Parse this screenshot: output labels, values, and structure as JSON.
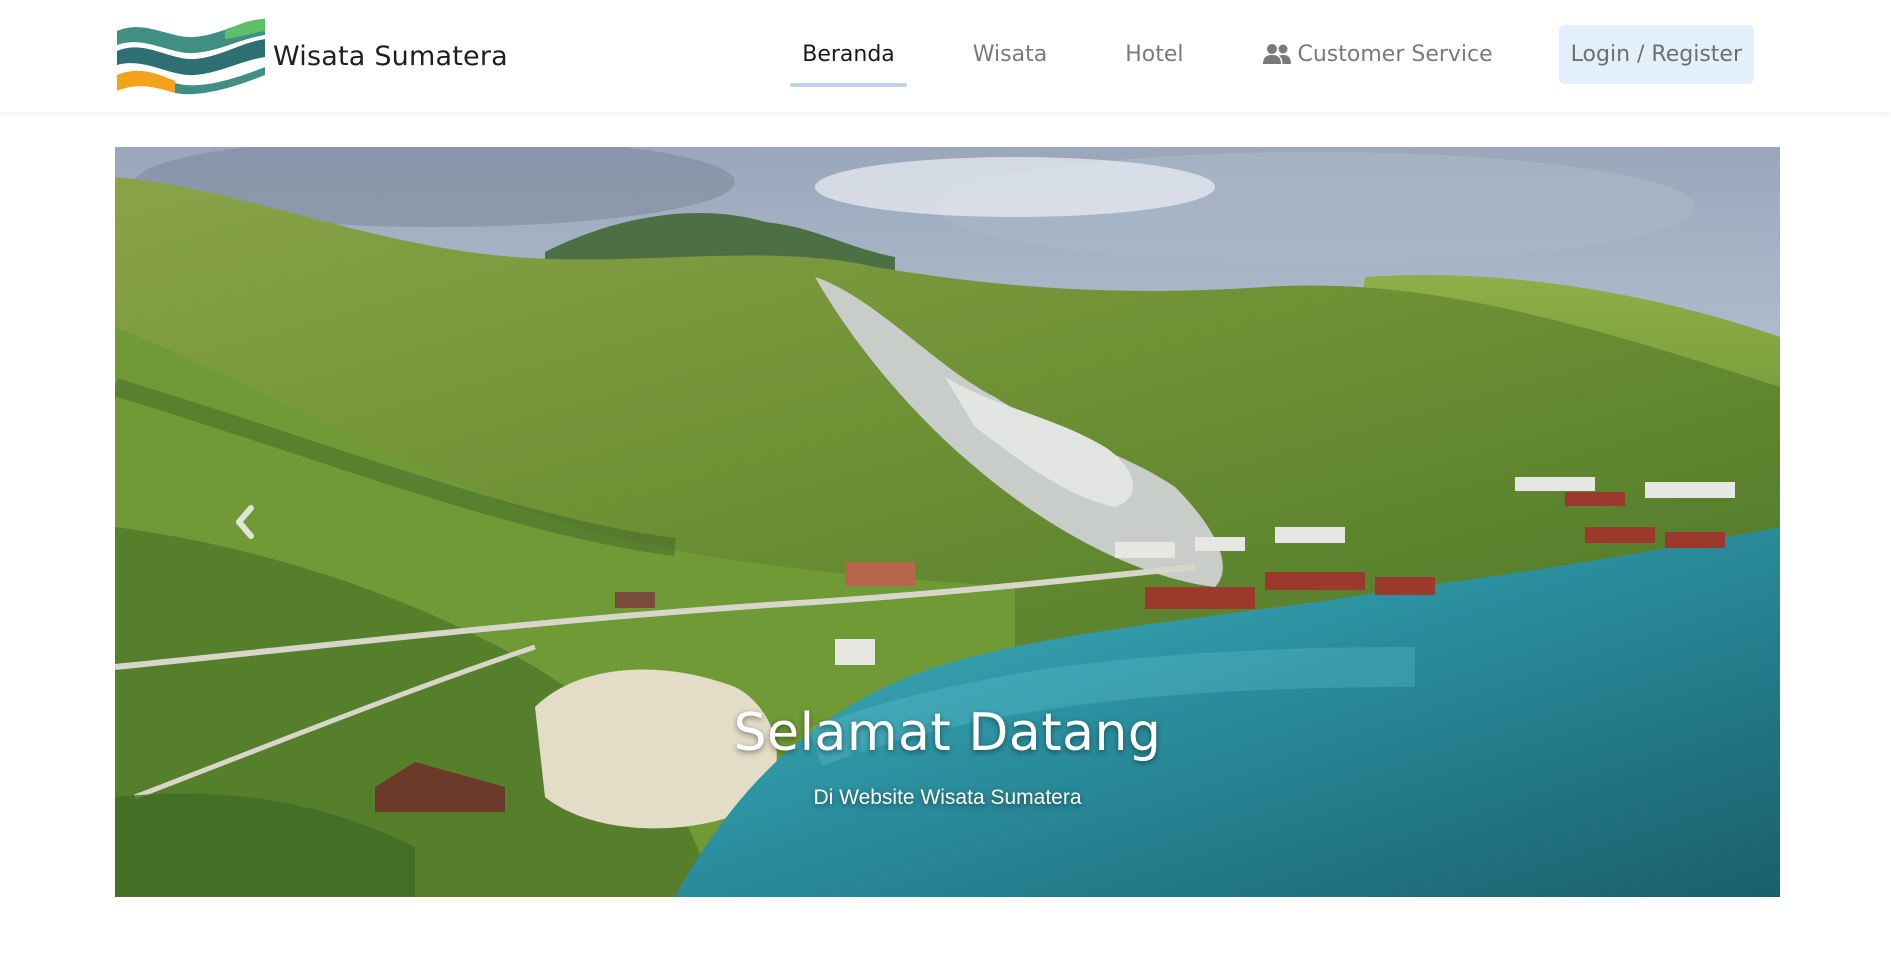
{
  "brand": {
    "name": "Wisata Sumatera",
    "logo_colors": [
      "#3f8f84",
      "#2e6f73",
      "#f4a21b",
      "#5cc06a"
    ]
  },
  "nav": {
    "items": [
      {
        "label": "Beranda",
        "active": true
      },
      {
        "label": "Wisata",
        "active": false
      },
      {
        "label": "Hotel",
        "active": false
      },
      {
        "label": "Customer Service",
        "active": false,
        "icon": "users-icon"
      }
    ],
    "login_label": "Login / Register"
  },
  "carousel": {
    "title": "Selamat Datang",
    "subtitle": "Di Website Wisata Sumatera",
    "prev_icon": "chevron-left-icon"
  },
  "colors": {
    "active_underline": "#bcd3ea",
    "login_bg": "#e3f0fb",
    "text_muted": "#7a7a7a"
  }
}
